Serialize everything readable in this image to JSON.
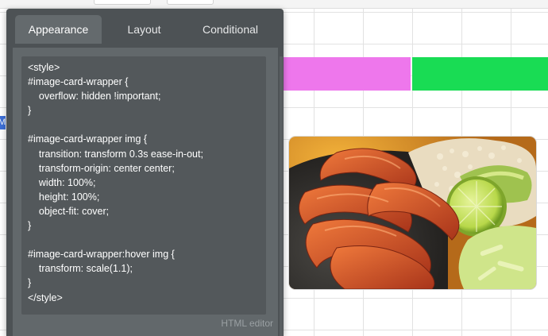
{
  "panel": {
    "tabs": [
      {
        "label": "Appearance",
        "active": true
      },
      {
        "label": "Layout",
        "active": false
      },
      {
        "label": "Conditional",
        "active": false
      }
    ],
    "editor_label": "HTML editor",
    "code_lines": [
      "<style>",
      "#image-card-wrapper {",
      "    overflow: hidden !important;",
      "}",
      "",
      "#image-card-wrapper img {",
      "    transition: transform 0.3s ease-in-out;",
      "    transform-origin: center center;",
      "    width: 100%;",
      "    height: 100%;",
      "    object-fit: cover;",
      "}",
      "",
      "#image-card-wrapper:hover img {",
      "    transform: scale(1.1);",
      "}",
      "</style>"
    ]
  },
  "canvas": {
    "left_tag": "M",
    "blocks": [
      {
        "name": "pink-block",
        "color": "#ee77ec"
      },
      {
        "name": "green-block",
        "color": "#19dc54"
      }
    ],
    "image_card": {
      "image": "grilled-shrimp-plate-image"
    }
  }
}
